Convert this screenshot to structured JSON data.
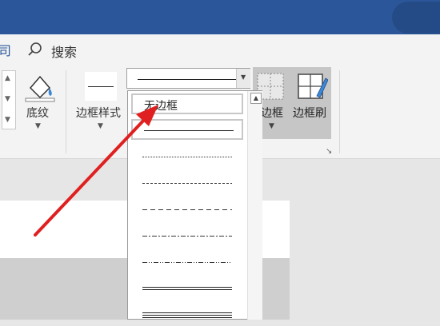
{
  "ribbon": {
    "tab_partial": "司",
    "search_label": "搜索",
    "shading_label": "底纹",
    "border_style_label": "边框样式",
    "borders_label": "边框",
    "border_painter_label": "边框刷"
  },
  "dropdown": {
    "items": [
      {
        "label": "无边框",
        "kind": "none"
      },
      {
        "kind": "solid"
      },
      {
        "kind": "dotted-fine"
      },
      {
        "kind": "dashed-fine"
      },
      {
        "kind": "dashed"
      },
      {
        "kind": "dash-dot"
      },
      {
        "kind": "dash-dot-dot"
      },
      {
        "kind": "double"
      },
      {
        "kind": "triple"
      }
    ],
    "selected": "无边框"
  },
  "colors": {
    "titlebar": "#2b579a",
    "ribbon_bg": "#f3f3f3",
    "highlight_group": "#c6c6c6",
    "annotation_arrow": "#e02020"
  },
  "icons": [
    "search-icon",
    "paint-bucket-icon",
    "borders-grid-icon",
    "border-painter-icon",
    "chevron-down-icon",
    "scroll-up-icon"
  ]
}
